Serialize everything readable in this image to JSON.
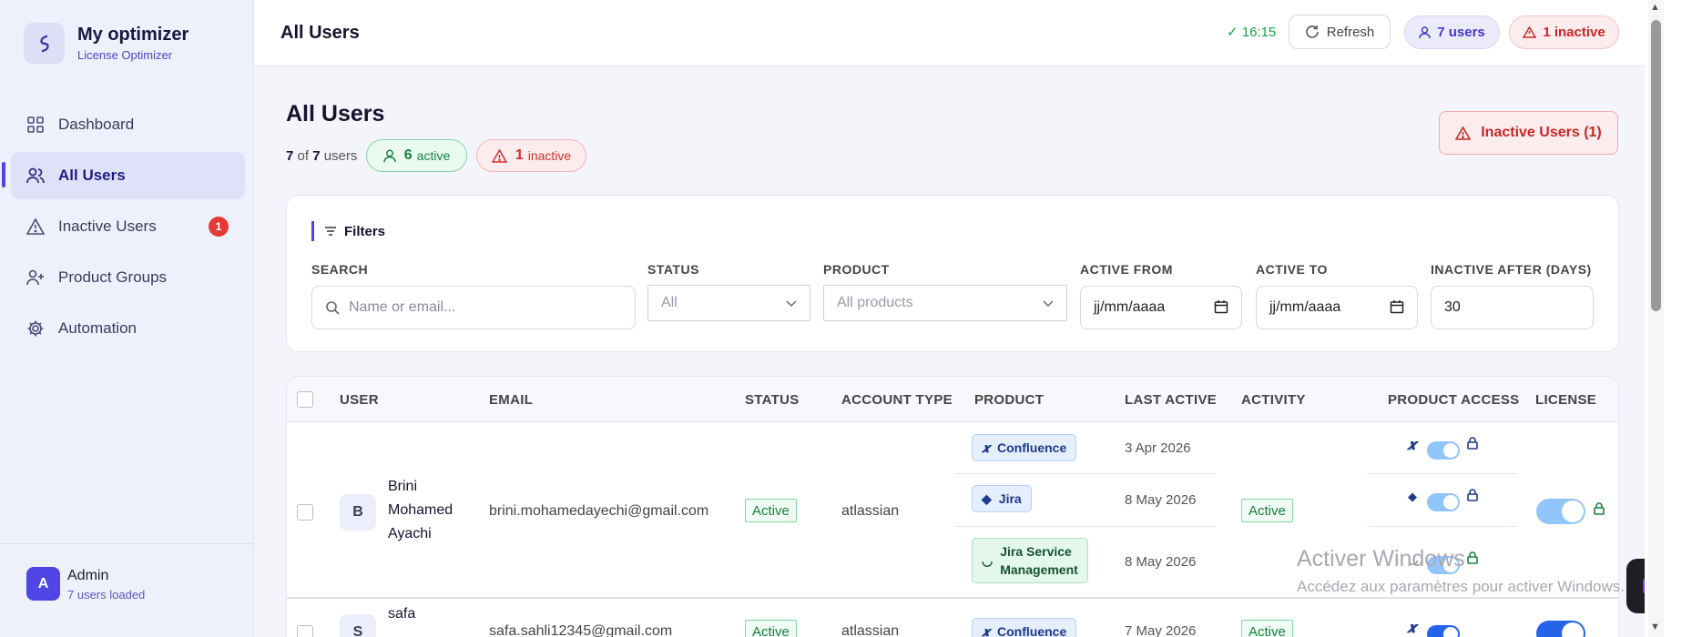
{
  "brand": {
    "name": "My optimizer",
    "subtitle": "License Optimizer"
  },
  "nav": [
    {
      "label": "Dashboard",
      "icon": "grid-icon"
    },
    {
      "label": "All Users",
      "icon": "users-icon",
      "active": true
    },
    {
      "label": "Inactive Users",
      "icon": "warning-icon",
      "badge": "1"
    },
    {
      "label": "Product Groups",
      "icon": "user-plus-icon"
    },
    {
      "label": "Automation",
      "icon": "gear-icon"
    }
  ],
  "admin": {
    "initial": "A",
    "name": "Admin",
    "subtitle": "7 users loaded"
  },
  "topbar": {
    "title": "All Users",
    "time": "✓ 16:15",
    "refresh_label": "Refresh",
    "users_pill": "7 users",
    "inactive_pill": "1 inactive"
  },
  "page": {
    "title": "All Users",
    "count_shown": "7",
    "count_of": "of",
    "count_total": "7",
    "count_suffix": "users",
    "active_count": "6",
    "active_label": "active",
    "inactive_count": "1",
    "inactive_label": "inactive",
    "inactive_button": "Inactive Users (1)"
  },
  "filters": {
    "title": "Filters",
    "search_label": "SEARCH",
    "search_placeholder": "Name or email...",
    "status_label": "STATUS",
    "status_value": "All",
    "product_label": "PRODUCT",
    "product_value": "All products",
    "active_from_label": "ACTIVE FROM",
    "active_from_value": "jj/mm/aaaa",
    "active_to_label": "ACTIVE TO",
    "active_to_value": "jj/mm/aaaa",
    "inactive_after_label": "INACTIVE AFTER (DAYS)",
    "inactive_after_value": "30"
  },
  "table": {
    "columns": [
      "USER",
      "EMAIL",
      "STATUS",
      "ACCOUNT TYPE",
      "PRODUCT",
      "LAST ACTIVE",
      "ACTIVITY",
      "PRODUCT ACCESS",
      "LICENSE"
    ],
    "rows": [
      {
        "initial": "B",
        "name_lines": [
          "Brini",
          "Mohamed",
          "Ayachi"
        ],
        "email": "brini.mohamedayechi@gmail.com",
        "status": "Active",
        "account_type": "atlassian",
        "products": [
          {
            "name": "Confluence",
            "last_active": "3 Apr 2026"
          },
          {
            "name": "Jira",
            "last_active": "8 May 2026"
          },
          {
            "name_lines": [
              "Jira Service",
              "Management"
            ],
            "last_active": "8 May 2026"
          }
        ],
        "activity": "Active"
      },
      {
        "initial": "S",
        "name_lines": [
          "safa"
        ],
        "email": "safa.sahli12345@gmail.com",
        "status": "Active",
        "account_type": "atlassian",
        "products": [
          {
            "name": "Confluence",
            "last_active": "7 May 2026"
          }
        ],
        "activity": "Active"
      }
    ]
  },
  "watermark": {
    "line1": "Activer Windows",
    "line2": "Accédez aux paramètres pour activer Windows."
  },
  "colors": {
    "accent": "#4f46e5",
    "active_green": "#15803d",
    "inactive_red": "#c62828",
    "toggle_blue": "#2563eb"
  }
}
